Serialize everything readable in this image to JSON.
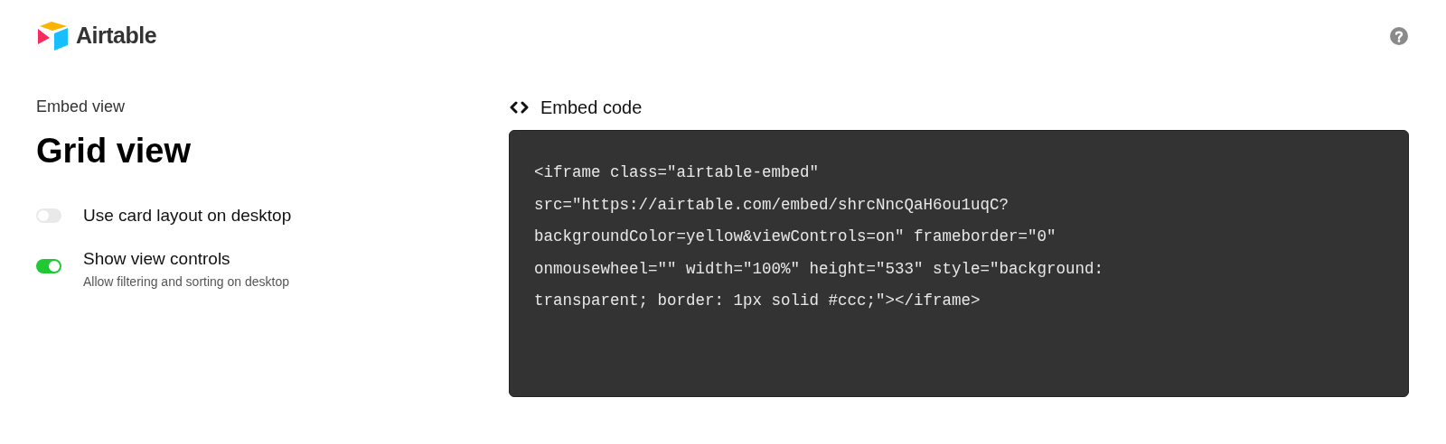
{
  "header": {
    "logo_text": "Airtable"
  },
  "settings": {
    "eyebrow": "Embed view",
    "title": "Grid view",
    "options": [
      {
        "label": "Use card layout on desktop",
        "on": false
      },
      {
        "label": "Show view controls",
        "description": "Allow filtering and sorting on desktop",
        "on": true
      }
    ]
  },
  "embed": {
    "heading": "Embed code",
    "code_lines": [
      "<iframe class=\"airtable-embed\"",
      "src=\"https://airtable.com/embed/shrcNncQaH6ou1uqC?",
      "backgroundColor=yellow&viewControls=on\" frameborder=\"0\"",
      "onmousewheel=\"\" width=\"100%\" height=\"533\" style=\"background:",
      "transparent; border: 1px solid #ccc;\"></iframe>"
    ]
  }
}
